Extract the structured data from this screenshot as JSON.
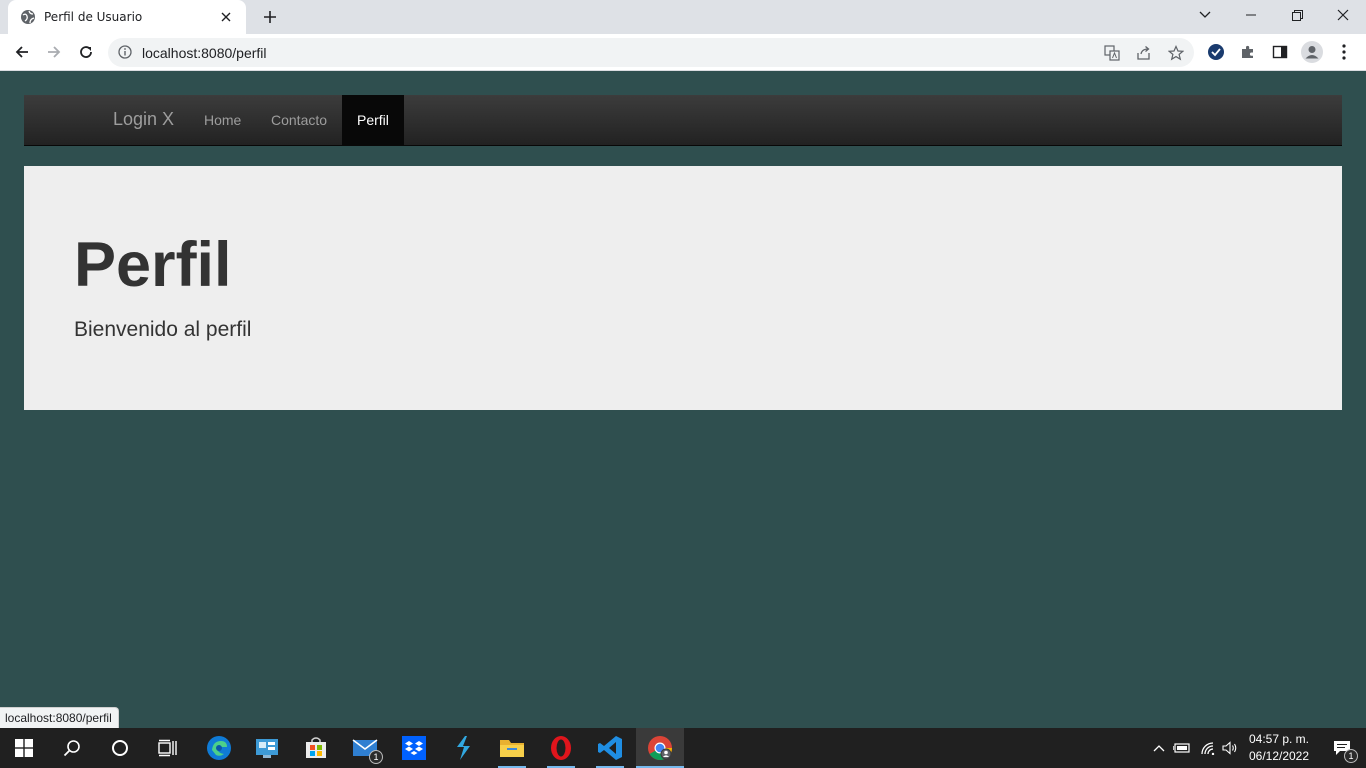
{
  "browser": {
    "tab": {
      "title": "Perfil de Usuario"
    },
    "address": {
      "url": "localhost:8080/perfil"
    },
    "status_bubble": "localhost:8080/perfil"
  },
  "page": {
    "navbar": {
      "brand": "Login X",
      "links": [
        {
          "label": "Home",
          "active": false
        },
        {
          "label": "Contacto",
          "active": false
        },
        {
          "label": "Perfil",
          "active": true
        }
      ]
    },
    "jumbotron": {
      "title": "Perfil",
      "text": "Bienvenido al perfil"
    },
    "colors": {
      "background": "#2f4f4f",
      "navbar": "#222222",
      "jumbotron": "#eeeeee",
      "heading": "#333333"
    }
  },
  "taskbar": {
    "apps": [
      {
        "icon": "windows-start-icon"
      },
      {
        "icon": "search-icon"
      },
      {
        "icon": "cortana-icon"
      },
      {
        "icon": "task-view-icon"
      },
      {
        "icon": "edge-icon"
      },
      {
        "icon": "control-panel-icon"
      },
      {
        "icon": "store-icon"
      },
      {
        "icon": "mail-icon",
        "badge": "1"
      },
      {
        "icon": "dropbox-icon"
      },
      {
        "icon": "visual-studio-icon"
      },
      {
        "icon": "file-explorer-icon"
      },
      {
        "icon": "opera-icon"
      },
      {
        "icon": "vscode-icon"
      },
      {
        "icon": "chrome-icon"
      }
    ],
    "clock": {
      "time": "04:57 p. m.",
      "date": "06/12/2022"
    },
    "notifications": "1"
  }
}
